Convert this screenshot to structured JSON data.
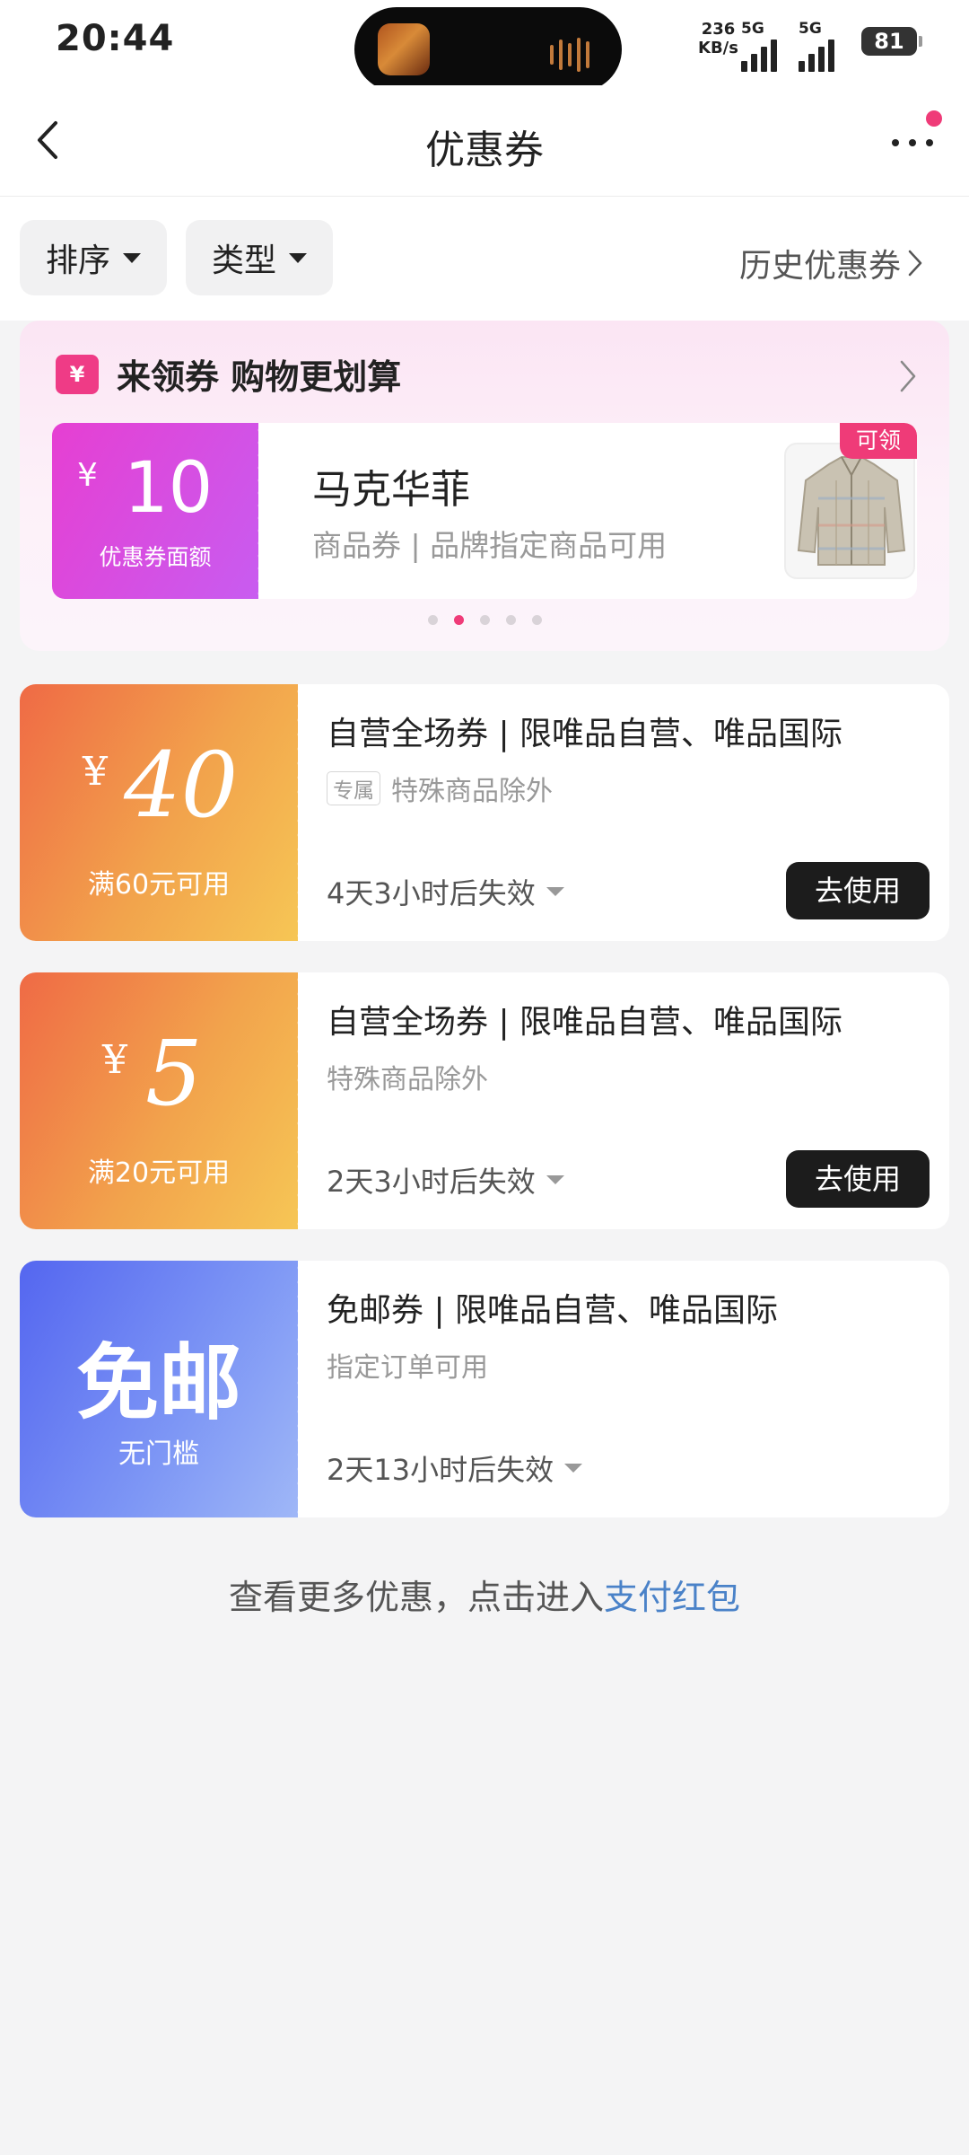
{
  "status_bar": {
    "time": "20:44",
    "net_speed_value": "236",
    "net_speed_unit": "KB/s",
    "sim1_label": "5G",
    "sim2_label": "5G",
    "battery": "81"
  },
  "header": {
    "title": "优惠券"
  },
  "filters": {
    "sort_label": "排序",
    "type_label": "类型",
    "history_label": "历史优惠券"
  },
  "promo": {
    "headline": "来领券 购物更划算",
    "badge_symbol": "¥",
    "card": {
      "currency": "¥",
      "amount": "10",
      "amount_label": "优惠券面额",
      "brand": "马克华菲",
      "description": "商品券 | 品牌指定商品可用",
      "tag": "可领"
    },
    "pagination": {
      "total": 5,
      "active_index": 1
    }
  },
  "coupons": [
    {
      "currency": "¥",
      "amount": "40",
      "condition": "满60元可用",
      "title": "自营全场券 | 限唯品自营、唯品国际",
      "exclusive_tag": "专属",
      "subtitle": "特殊商品除外",
      "expiry": "4天3小时后失效",
      "action_label": "去使用"
    },
    {
      "currency": "¥",
      "amount": "5",
      "condition": "满20元可用",
      "title": "自营全场券 | 限唯品自营、唯品国际",
      "subtitle": "特殊商品除外",
      "expiry": "2天3小时后失效",
      "action_label": "去使用"
    },
    {
      "big_label": "免邮",
      "condition": "无门槛",
      "title": "免邮券 | 限唯品自营、唯品国际",
      "subtitle": "指定订单可用",
      "expiry": "2天13小时后失效"
    }
  ],
  "footer": {
    "text": "查看更多优惠，点击进入",
    "link_text": "支付红包"
  },
  "colors": {
    "accent_pink": "#ef3b78",
    "promo_purple": "#d04fe6",
    "coupon_orange": "#f2a34c",
    "coupon_blue": "#6f84f3",
    "link_blue": "#4a82c8",
    "button_dark": "#1c1c1c"
  },
  "icons": [
    "back-arrow-icon",
    "more-dots-icon",
    "caret-down-icon",
    "chevron-right-icon",
    "yen-icon",
    "jacket-thumbnail",
    "audio-wave-icon",
    "signal-icon",
    "battery-icon"
  ]
}
